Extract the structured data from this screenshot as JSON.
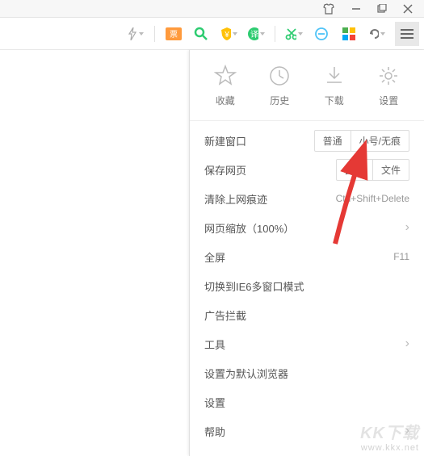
{
  "quick": {
    "favorites": "收藏",
    "history": "历史",
    "downloads": "下载",
    "settings": "设置"
  },
  "menu": {
    "new_window": "新建窗口",
    "new_window_opts": {
      "normal": "普通",
      "private": "小号/无痕"
    },
    "save_page": "保存网页",
    "save_page_opts": {
      "image": "图片",
      "file": "文件"
    },
    "clear_traces": "清除上网痕迹",
    "clear_traces_shortcut": "Ctrl+Shift+Delete",
    "zoom": "网页缩放（100%）",
    "fullscreen": "全屏",
    "fullscreen_shortcut": "F11",
    "ie6_mode": "切换到IE6多窗口模式",
    "adblock": "广告拦截",
    "tools": "工具",
    "set_default": "设置为默认浏览器",
    "settings": "设置",
    "help": "帮助"
  },
  "watermark": {
    "logo": "KK下载",
    "url": "www.kkx.net"
  }
}
